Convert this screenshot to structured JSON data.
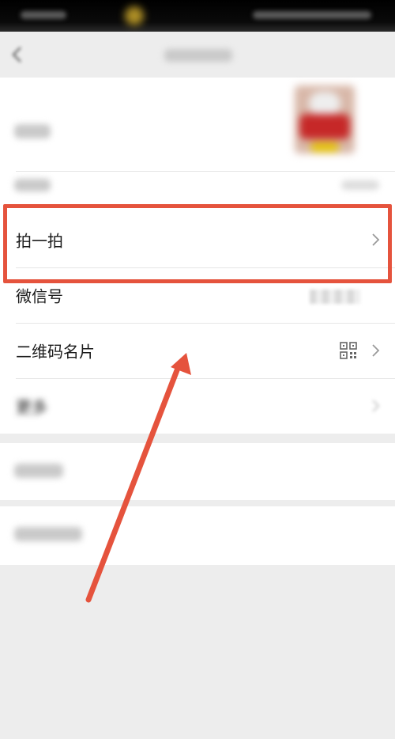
{
  "status_bar": {},
  "header": {
    "back_icon": "back-arrow-icon",
    "title": ""
  },
  "profile": {
    "avatar_label": "",
    "name_label": "",
    "rows": [
      {
        "id": "pat",
        "label": "拍一拍",
        "icon": "chevron-right-icon"
      },
      {
        "id": "wechat-id",
        "label": "微信号",
        "value": ""
      },
      {
        "id": "qr-card",
        "label": "二维码名片",
        "icon": "qr-code-icon"
      },
      {
        "id": "more",
        "label": "更多"
      }
    ]
  },
  "extra": {
    "row1_label": "",
    "row2_label": ""
  },
  "colors": {
    "highlight": "#e5533d",
    "arrow": "#e5533d",
    "background": "#ededed",
    "card": "#ffffff"
  }
}
